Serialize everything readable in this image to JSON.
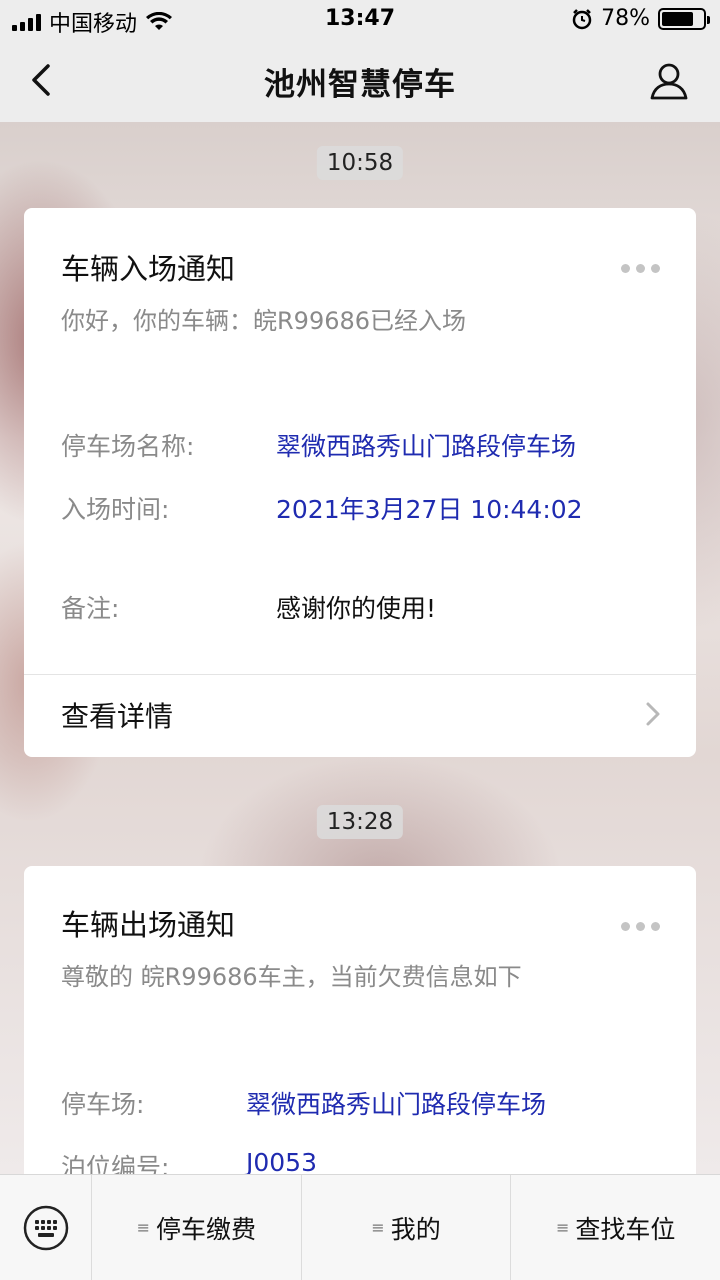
{
  "status_bar": {
    "carrier": "中国移动",
    "time": "13:47",
    "battery": "78%",
    "battery_level": 0.78
  },
  "nav": {
    "title": "池州智慧停车"
  },
  "messages": [
    {
      "time": "10:58",
      "title": "车辆入场通知",
      "subtitle": "你好，你的车辆：皖R99686已经入场",
      "fields": [
        {
          "label": "停车场名称:",
          "value": "翠微西路秀山门路段停车场"
        },
        {
          "label": "入场时间:",
          "value": "2021年3月27日 10:44:02"
        },
        {
          "label": "备注:",
          "value": "感谢你的使用!"
        }
      ],
      "detail": "查看详情"
    },
    {
      "time": "13:28",
      "title": "车辆出场通知",
      "subtitle": "尊敬的 皖R99686车主，当前欠费信息如下",
      "fields": [
        {
          "label": "停车场:",
          "value": "翠微西路秀山门路段停车场"
        },
        {
          "label": "泊位编号:",
          "value": "J0053"
        }
      ]
    }
  ],
  "bottom_menu": {
    "items": [
      "停车缴费",
      "我的",
      "查找车位"
    ]
  },
  "colors": {
    "link_blue": "#1f2bb0",
    "bar_bg": "#ededed"
  }
}
